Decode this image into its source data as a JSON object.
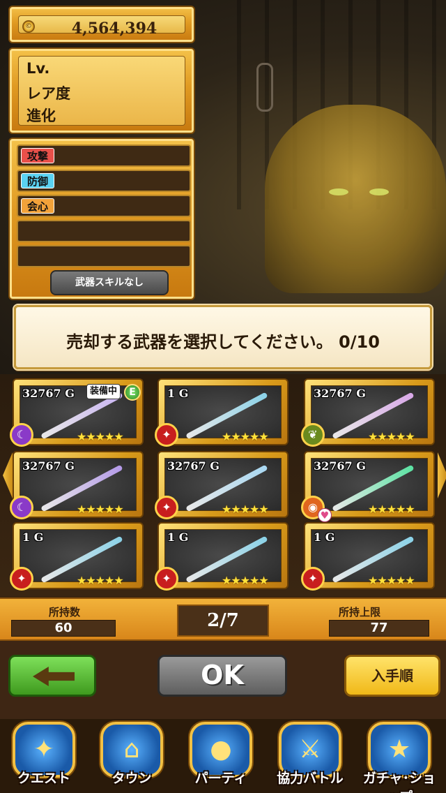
{
  "currency": {
    "value": "4,564,394"
  },
  "info": {
    "level_label": "Lv.",
    "rarity_label": "レア度",
    "evolution_label": "進化"
  },
  "stats": [
    {
      "label": "攻撃",
      "color": "#e8504a"
    },
    {
      "label": "防御",
      "color": "#5ad2f2"
    },
    {
      "label": "会心",
      "color": "#f2a23a"
    }
  ],
  "skill_button": "武器スキルなし",
  "message": "売却する武器を選択してください。 0/10",
  "weapons": [
    {
      "price": "32767 G",
      "equipped_label": "装備中",
      "equip_mark": "E",
      "element": "purple",
      "weapon_color": "#c9b4f2"
    },
    {
      "price": "1 G",
      "element": "red",
      "weapon_color": "#8ad2e8"
    },
    {
      "price": "32767 G",
      "element": "green",
      "weapon_color": "#d8a8e8"
    },
    {
      "price": "32767 G",
      "element": "purple",
      "weapon_color": "#b49ae8"
    },
    {
      "price": "32767 G",
      "element": "red",
      "weapon_color": "#a8d8f2"
    },
    {
      "price": "32767 G",
      "element": "orange",
      "weapon_color": "#5ae2a2",
      "locked": true
    },
    {
      "price": "1 G",
      "element": "red",
      "weapon_color": "#8ad2e8"
    },
    {
      "price": "1 G",
      "element": "red",
      "weapon_color": "#8ad2e8"
    },
    {
      "price": "1 G",
      "element": "red",
      "weapon_color": "#8ad2e8"
    }
  ],
  "stars": "★★★★★",
  "counts": {
    "owned_label": "所持数",
    "owned_value": "60",
    "page": "2/7",
    "limit_label": "所持上限",
    "limit_value": "77"
  },
  "actions": {
    "ok": "OK",
    "sort": "入手順"
  },
  "nav": [
    {
      "label": "クエスト",
      "icon": "quest-icon"
    },
    {
      "label": "タウン",
      "icon": "town-icon"
    },
    {
      "label": "パーティ",
      "icon": "party-icon"
    },
    {
      "label": "協力バトル",
      "icon": "coop-battle-icon"
    },
    {
      "label": "ガチャ･ショップ",
      "icon": "gacha-shop-icon"
    }
  ]
}
